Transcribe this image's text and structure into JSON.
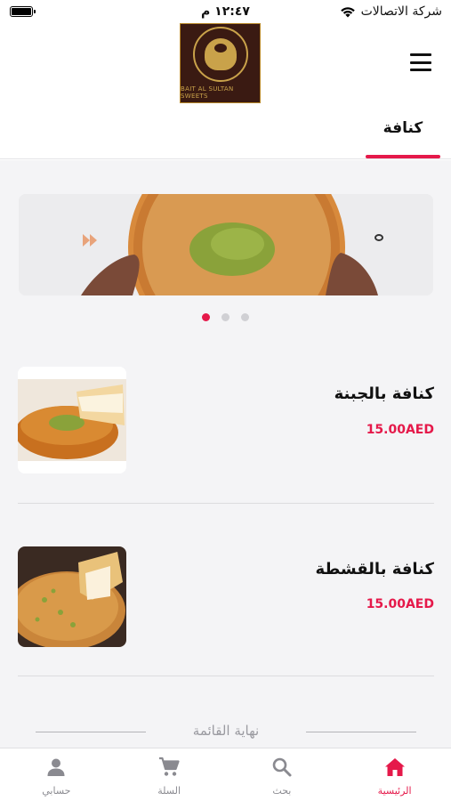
{
  "status_bar": {
    "carrier": "شركة الاتصالات",
    "time": "١٢:٤٧ م"
  },
  "header": {
    "logo_text": "BAIT AL SULTAN SWEETS",
    "active_tab": "كنافة"
  },
  "carousel": {
    "page_count": 3,
    "active_index": 0
  },
  "products": [
    {
      "name": "كنافة بالجبنة",
      "price": "15.00AED"
    },
    {
      "name": "كنافة بالقشطة",
      "price": "15.00AED"
    }
  ],
  "end_of_list": "نهاية القائمة",
  "bottom_nav": {
    "items": [
      {
        "label": "الرئيسية",
        "icon": "home-icon",
        "active": true
      },
      {
        "label": "بحث",
        "icon": "search-icon",
        "active": false
      },
      {
        "label": "السلة",
        "icon": "cart-icon",
        "active": false
      },
      {
        "label": "حسابي",
        "icon": "user-icon",
        "active": false
      }
    ]
  },
  "colors": {
    "accent": "#e5194a",
    "background": "#f4f4f6",
    "logo_bg": "#3a1a12",
    "logo_gold": "#c9a24a"
  }
}
